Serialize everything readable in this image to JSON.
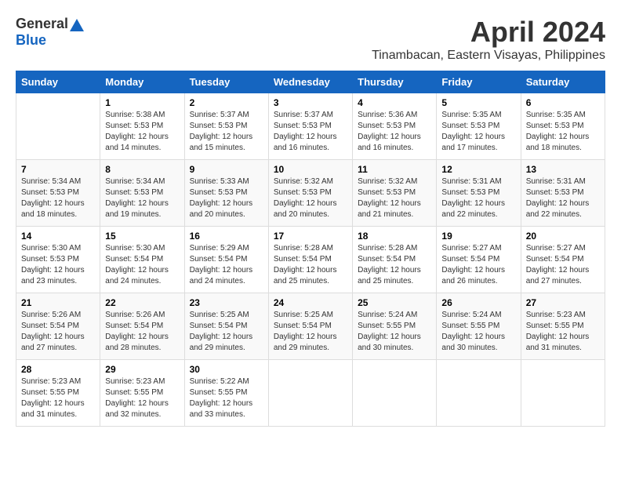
{
  "header": {
    "logo_general": "General",
    "logo_blue": "Blue",
    "month_year": "April 2024",
    "location": "Tinambacan, Eastern Visayas, Philippines"
  },
  "days_of_week": [
    "Sunday",
    "Monday",
    "Tuesday",
    "Wednesday",
    "Thursday",
    "Friday",
    "Saturday"
  ],
  "weeks": [
    [
      {
        "day": "",
        "info": ""
      },
      {
        "day": "1",
        "info": "Sunrise: 5:38 AM\nSunset: 5:53 PM\nDaylight: 12 hours\nand 14 minutes."
      },
      {
        "day": "2",
        "info": "Sunrise: 5:37 AM\nSunset: 5:53 PM\nDaylight: 12 hours\nand 15 minutes."
      },
      {
        "day": "3",
        "info": "Sunrise: 5:37 AM\nSunset: 5:53 PM\nDaylight: 12 hours\nand 16 minutes."
      },
      {
        "day": "4",
        "info": "Sunrise: 5:36 AM\nSunset: 5:53 PM\nDaylight: 12 hours\nand 16 minutes."
      },
      {
        "day": "5",
        "info": "Sunrise: 5:35 AM\nSunset: 5:53 PM\nDaylight: 12 hours\nand 17 minutes."
      },
      {
        "day": "6",
        "info": "Sunrise: 5:35 AM\nSunset: 5:53 PM\nDaylight: 12 hours\nand 18 minutes."
      }
    ],
    [
      {
        "day": "7",
        "info": "Sunrise: 5:34 AM\nSunset: 5:53 PM\nDaylight: 12 hours\nand 18 minutes."
      },
      {
        "day": "8",
        "info": "Sunrise: 5:34 AM\nSunset: 5:53 PM\nDaylight: 12 hours\nand 19 minutes."
      },
      {
        "day": "9",
        "info": "Sunrise: 5:33 AM\nSunset: 5:53 PM\nDaylight: 12 hours\nand 20 minutes."
      },
      {
        "day": "10",
        "info": "Sunrise: 5:32 AM\nSunset: 5:53 PM\nDaylight: 12 hours\nand 20 minutes."
      },
      {
        "day": "11",
        "info": "Sunrise: 5:32 AM\nSunset: 5:53 PM\nDaylight: 12 hours\nand 21 minutes."
      },
      {
        "day": "12",
        "info": "Sunrise: 5:31 AM\nSunset: 5:53 PM\nDaylight: 12 hours\nand 22 minutes."
      },
      {
        "day": "13",
        "info": "Sunrise: 5:31 AM\nSunset: 5:53 PM\nDaylight: 12 hours\nand 22 minutes."
      }
    ],
    [
      {
        "day": "14",
        "info": "Sunrise: 5:30 AM\nSunset: 5:53 PM\nDaylight: 12 hours\nand 23 minutes."
      },
      {
        "day": "15",
        "info": "Sunrise: 5:30 AM\nSunset: 5:54 PM\nDaylight: 12 hours\nand 24 minutes."
      },
      {
        "day": "16",
        "info": "Sunrise: 5:29 AM\nSunset: 5:54 PM\nDaylight: 12 hours\nand 24 minutes."
      },
      {
        "day": "17",
        "info": "Sunrise: 5:28 AM\nSunset: 5:54 PM\nDaylight: 12 hours\nand 25 minutes."
      },
      {
        "day": "18",
        "info": "Sunrise: 5:28 AM\nSunset: 5:54 PM\nDaylight: 12 hours\nand 25 minutes."
      },
      {
        "day": "19",
        "info": "Sunrise: 5:27 AM\nSunset: 5:54 PM\nDaylight: 12 hours\nand 26 minutes."
      },
      {
        "day": "20",
        "info": "Sunrise: 5:27 AM\nSunset: 5:54 PM\nDaylight: 12 hours\nand 27 minutes."
      }
    ],
    [
      {
        "day": "21",
        "info": "Sunrise: 5:26 AM\nSunset: 5:54 PM\nDaylight: 12 hours\nand 27 minutes."
      },
      {
        "day": "22",
        "info": "Sunrise: 5:26 AM\nSunset: 5:54 PM\nDaylight: 12 hours\nand 28 minutes."
      },
      {
        "day": "23",
        "info": "Sunrise: 5:25 AM\nSunset: 5:54 PM\nDaylight: 12 hours\nand 29 minutes."
      },
      {
        "day": "24",
        "info": "Sunrise: 5:25 AM\nSunset: 5:54 PM\nDaylight: 12 hours\nand 29 minutes."
      },
      {
        "day": "25",
        "info": "Sunrise: 5:24 AM\nSunset: 5:55 PM\nDaylight: 12 hours\nand 30 minutes."
      },
      {
        "day": "26",
        "info": "Sunrise: 5:24 AM\nSunset: 5:55 PM\nDaylight: 12 hours\nand 30 minutes."
      },
      {
        "day": "27",
        "info": "Sunrise: 5:23 AM\nSunset: 5:55 PM\nDaylight: 12 hours\nand 31 minutes."
      }
    ],
    [
      {
        "day": "28",
        "info": "Sunrise: 5:23 AM\nSunset: 5:55 PM\nDaylight: 12 hours\nand 31 minutes."
      },
      {
        "day": "29",
        "info": "Sunrise: 5:23 AM\nSunset: 5:55 PM\nDaylight: 12 hours\nand 32 minutes."
      },
      {
        "day": "30",
        "info": "Sunrise: 5:22 AM\nSunset: 5:55 PM\nDaylight: 12 hours\nand 33 minutes."
      },
      {
        "day": "",
        "info": ""
      },
      {
        "day": "",
        "info": ""
      },
      {
        "day": "",
        "info": ""
      },
      {
        "day": "",
        "info": ""
      }
    ]
  ]
}
